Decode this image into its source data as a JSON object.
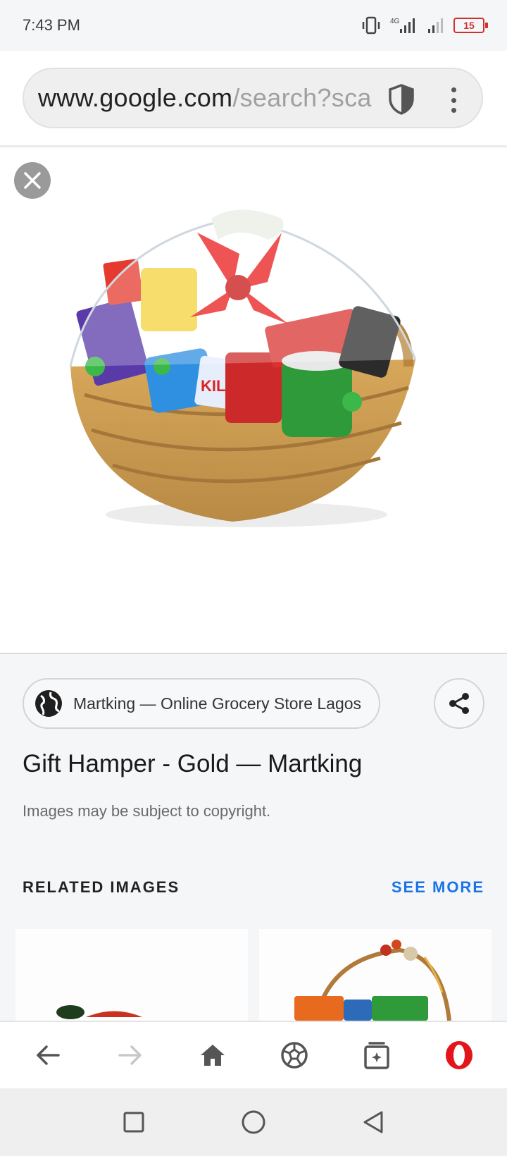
{
  "status_bar": {
    "time": "7:43 PM",
    "battery": "15",
    "network": "4G"
  },
  "url_bar": {
    "domain": "www.google.com",
    "path": "/search?sca"
  },
  "viewer": {
    "close_icon": "close-icon"
  },
  "info": {
    "source": "Martking — Online Grocery Store Lagos",
    "title": "Gift Hamper - Gold — Martking",
    "copyright": "Images may be subject to copyright.",
    "related_label": "RELATED IMAGES",
    "see_more": "SEE MORE"
  },
  "browser_nav": {
    "items": [
      "back-icon",
      "forward-icon",
      "home-icon",
      "soccer-ball-icon",
      "tabs-icon",
      "opera-icon"
    ]
  },
  "system_nav": {
    "items": [
      "recents-icon",
      "home-circle-icon",
      "back-triangle-icon"
    ]
  },
  "colors": {
    "accent": "#1a73e8",
    "opera_red": "#e3141c",
    "battery_red": "#d0312d"
  }
}
